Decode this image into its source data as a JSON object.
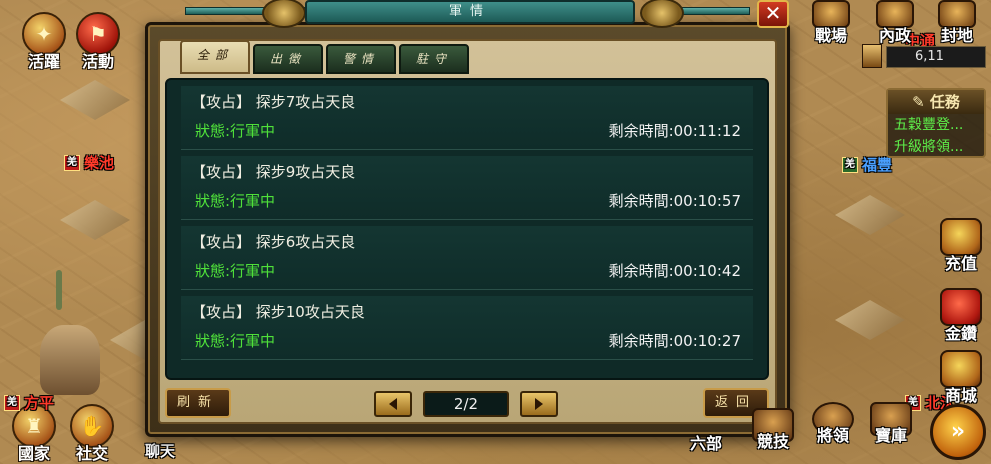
{
  "dialog": {
    "title": "軍情",
    "close_label": "✕",
    "tabs": [
      {
        "label": "全部",
        "active": true
      },
      {
        "label": "出徵",
        "active": false
      },
      {
        "label": "警情",
        "active": false
      },
      {
        "label": "駐守",
        "active": false
      }
    ],
    "rows": [
      {
        "title": "【攻占】 探步7攻占天良",
        "status": "狀態:行軍中",
        "time": "剩余時間:00:11:12"
      },
      {
        "title": "【攻占】 探步9攻占天良",
        "status": "狀態:行軍中",
        "time": "剩余時間:00:10:57"
      },
      {
        "title": "【攻占】 探步6攻占天良",
        "status": "狀態:行軍中",
        "time": "剩余時間:00:10:42"
      },
      {
        "title": "【攻占】 探步10攻占天良",
        "status": "狀態:行軍中",
        "time": "剩余時間:00:10:27"
      }
    ],
    "refresh_label": "刷新",
    "back_label": "返回",
    "page": "2/2"
  },
  "left_menu": {
    "activity_spirit": "活躍",
    "activity": "活動",
    "country": "國家",
    "social": "社交",
    "chat": "聊天"
  },
  "map_labels": {
    "lechi": "樂池",
    "fangping": "方平",
    "fuchu": "福豐",
    "zhongtong": "中通",
    "beiji": "北汄"
  },
  "top_menu": {
    "battlefield": "戰場",
    "internal": "內政",
    "fief": "封地"
  },
  "coords": "6,11",
  "tasks": {
    "header": "任務",
    "items": [
      "五穀豐登...",
      "升級將領..."
    ]
  },
  "right_menu": {
    "recharge": "充值",
    "gold": "金鑽",
    "shop": "商城"
  },
  "bottom_menu": {
    "six": "六部",
    "compete": "競技",
    "general": "將領",
    "treasury": "寶庫"
  },
  "colors": {
    "status_green": "#4fe03a",
    "panel_bg": "#0f2a27",
    "gold_border": "#c89b48"
  }
}
